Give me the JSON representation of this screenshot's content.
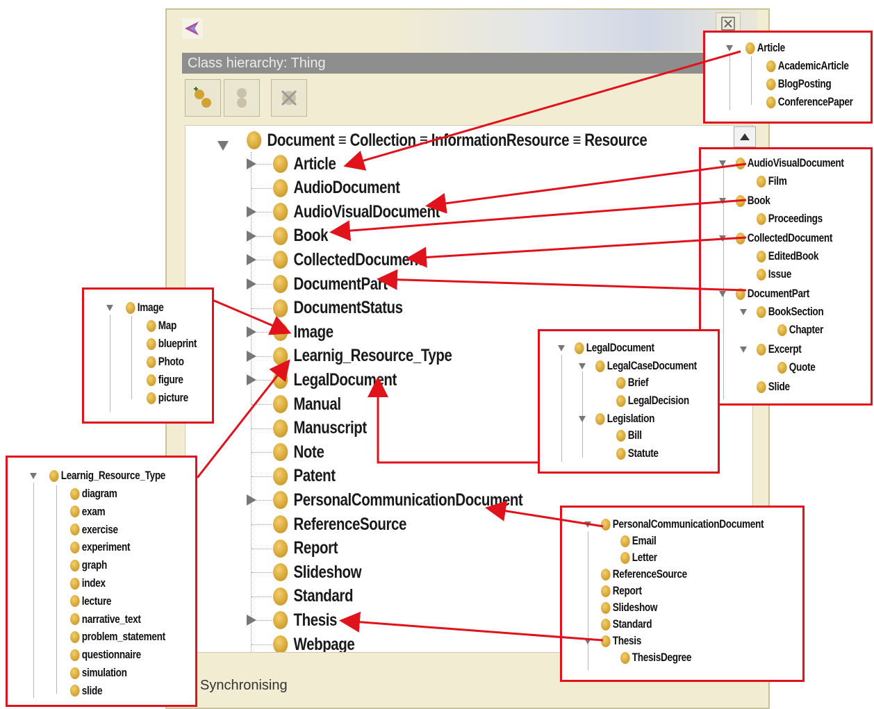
{
  "window": {
    "panel_title": "Class hierarchy: Thing",
    "sync_label": "Synchronising"
  },
  "tree": {
    "root": "Document ≡ Collection ≡ InformationResource ≡ Resource",
    "items": [
      {
        "label": "Article",
        "expandable": true
      },
      {
        "label": "AudioDocument",
        "expandable": false
      },
      {
        "label": "AudioVisualDocument",
        "expandable": true
      },
      {
        "label": "Book",
        "expandable": true
      },
      {
        "label": "CollectedDocument",
        "expandable": true
      },
      {
        "label": "DocumentPart",
        "expandable": true
      },
      {
        "label": "DocumentStatus",
        "expandable": false
      },
      {
        "label": "Image",
        "expandable": true
      },
      {
        "label": "Learnig_Resource_Type",
        "expandable": true
      },
      {
        "label": "LegalDocument",
        "expandable": true
      },
      {
        "label": "Manual",
        "expandable": false
      },
      {
        "label": "Manuscript",
        "expandable": false
      },
      {
        "label": "Note",
        "expandable": false
      },
      {
        "label": "Patent",
        "expandable": false
      },
      {
        "label": "PersonalCommunicationDocument",
        "expandable": true
      },
      {
        "label": "ReferenceSource",
        "expandable": false
      },
      {
        "label": "Report",
        "expandable": false
      },
      {
        "label": "Slideshow",
        "expandable": false
      },
      {
        "label": "Standard",
        "expandable": false
      },
      {
        "label": "Thesis",
        "expandable": true
      },
      {
        "label": "Webpage",
        "expandable": false
      }
    ]
  },
  "callouts": {
    "article": {
      "parent": "Article",
      "children": [
        "AcademicArticle",
        "BlogPosting",
        "ConferencePaper"
      ]
    },
    "av": {
      "groups": [
        {
          "label": "AudioVisualDocument",
          "children": [
            "Film"
          ]
        },
        {
          "label": "Book",
          "children": [
            "Proceedings"
          ]
        },
        {
          "label": "CollectedDocument",
          "children": [
            "EditedBook",
            "Issue"
          ]
        },
        {
          "label": "DocumentPart",
          "children": []
        },
        {
          "label": "BookSection",
          "children": [
            "Chapter"
          ]
        },
        {
          "label": "Excerpt",
          "children": [
            "Quote"
          ]
        },
        {
          "label": "Slide",
          "children": []
        }
      ]
    },
    "image": {
      "parent": "Image",
      "children": [
        "Map",
        "blueprint",
        "Photo",
        "figure",
        "picture"
      ]
    },
    "legal": {
      "parent": "LegalDocument",
      "case": "LegalCaseDocument",
      "case_children": [
        "Brief",
        "LegalDecision"
      ],
      "legislation": "Legislation",
      "legislation_children": [
        "Bill",
        "Statute"
      ]
    },
    "learning": {
      "parent": "Learnig_Resource_Type",
      "children": [
        "diagram",
        "exam",
        "exercise",
        "experiment",
        "graph",
        "index",
        "lecture",
        "narrative_text",
        "problem_statement",
        "questionnaire",
        "simulation",
        "slide"
      ]
    },
    "pcd": {
      "parent": "PersonalCommunicationDocument",
      "pcd_children": [
        "Email",
        "Letter"
      ],
      "others": [
        "ReferenceSource",
        "Report",
        "Slideshow",
        "Standard",
        "Thesis"
      ],
      "thesis_children": [
        "ThesisDegree"
      ]
    }
  },
  "colors": {
    "callout_border": "#e0121b",
    "arrow": "#e0121b",
    "node": "#d2a233",
    "title_bar": "#8e8e8e"
  }
}
